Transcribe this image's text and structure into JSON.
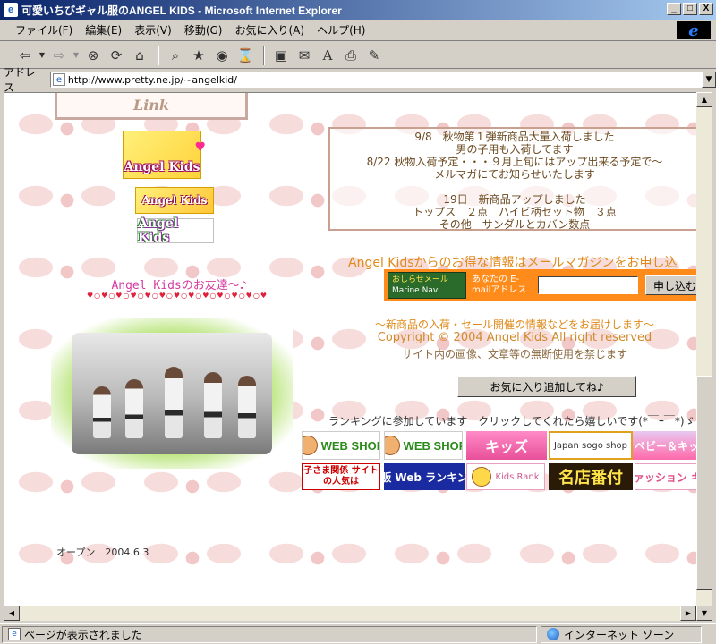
{
  "window": {
    "title": "可愛いちびギャル服のANGEL KIDS - Microsoft Internet Explorer",
    "min_label": "_",
    "max_label": "□",
    "close_label": "X"
  },
  "menu": [
    "ファイル(F)",
    "編集(E)",
    "表示(V)",
    "移動(G)",
    "お気に入り(A)",
    "ヘルプ(H)"
  ],
  "address": {
    "label": "アドレス",
    "url": "http://www.pretty.ne.jp/~angelkid/"
  },
  "page": {
    "link_banner": "Link",
    "banner_a": "Angel Kids",
    "banner_b": "Angel Kids",
    "banner_c": "Angel Kids",
    "friends_title": "Angel Kidsのお友達～♪",
    "deco_line": "♥○♥○♥○♥○♥○♥○♥○♥○♥○♥○♥○♥○♥",
    "news": [
      "9/8　秋物第１弾新商品大量入荷しました",
      "男の子用も入荷してます",
      "8/22 秋物入荷予定・・・９月上旬にはアップ出来る予定で～",
      "メルマガにてお知らせいたします",
      "",
      "19日　新商品アップしました",
      "トップス　２点　ハイビ柄セット物　３点",
      "その他　サンダルとカバン数点"
    ],
    "mail_heading": "Angel Kidsからのお得な情報はメールマガジンをお申し込",
    "mail_icon_line1": "おしらせメール",
    "mail_icon_line2": "Marine Navi",
    "mail_label": "あなたの E-mailアドレス",
    "mail_button": "申し込む",
    "info_line": "～新商品の入荷・セール開催の情報などをお届けします～",
    "copyright": "Copyright © 2004 Angel Kids All right reserved",
    "notice": "サイト内の画像、文章等の無断使用を禁じます",
    "fav_button": "お気に入り追加してね♪",
    "ranking_text": "ランキングに参加しています　クリックしてくれたら嬉しいです(*￣ｰ￣*)ゞ",
    "rank_banners": [
      "WEB SHOP",
      "WEB SHOP",
      "キッズ",
      "Japan sogo shop",
      "ベビー＆キッ",
      "子さま関係 サイトの人気は",
      "通販 Web ランキング",
      "Kids Rank",
      "名店番付",
      "ファッション キッ"
    ],
    "opened": "オープン　2004.6.3"
  },
  "status": {
    "left": "ページが表示されました",
    "right": "インターネット ゾーン"
  },
  "colors": {
    "titlebar": "#0a246a",
    "accent_orange": "#ff8c1a",
    "pink_text": "#d43aa0"
  }
}
